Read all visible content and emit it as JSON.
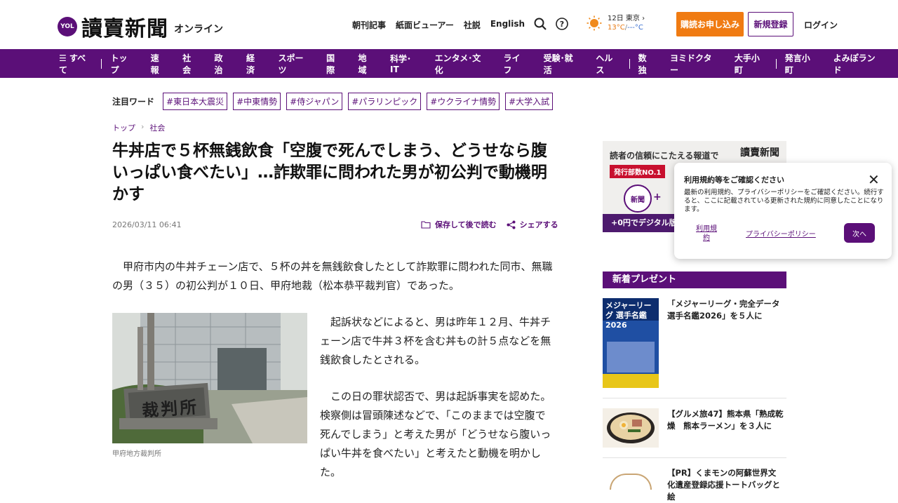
{
  "header": {
    "logo_badge": "YOL",
    "logo_main": "讀賣新聞",
    "logo_sub": "オンライン",
    "links": [
      "朝刊記事",
      "紙面ビューアー",
      "社説",
      "English"
    ],
    "weather": {
      "date_city": "12日 東京",
      "chevron": "›",
      "temp_max": "13°C",
      "temp_sep": "/",
      "temp_min": "---°C",
      "icon": "sun-icon"
    },
    "subscribe": "購読お申し込み",
    "register": "新規登録",
    "login": "ログイン"
  },
  "nav": {
    "all": "☰ すべて",
    "items": [
      "トップ",
      "速報",
      "社会",
      "政治",
      "経済",
      "スポーツ",
      "国際",
      "地域",
      "科学･IT",
      "エンタメ･文化",
      "ライフ",
      "受験･就活",
      "ヘルス"
    ],
    "items2": [
      "数独",
      "ヨミドクター",
      "大手小町"
    ],
    "items3": [
      "発言小町",
      "よみぽランド"
    ]
  },
  "keywords": {
    "label": "注目ワード",
    "tags": [
      "#東日本大震災",
      "#中東情勢",
      "#侍ジャパン",
      "#パラリンピック",
      "#ウクライナ情勢",
      "#大学入試"
    ]
  },
  "breadcrumb": {
    "home": "トップ",
    "sep": "›",
    "section": "社会"
  },
  "article": {
    "title": "牛丼店で５杯無銭飲食「空腹で死んでしまう、どうせなら腹いっぱい食べたい」…詐欺罪に問われた男が初公判で動機明かす",
    "date": "2026/03/11 06:41",
    "save": "保存して後で読む",
    "share": "シェアする",
    "lead": "　甲府市内の牛丼チェーン店で、５杯の丼を無銭飲食したとして詐欺罪に問われた同市、無職の男（３５）の初公判が１０日、甲府地裁（松本恭平裁判官）であった。",
    "para1": "　起訴状などによると、男は昨年１２月、牛丼チェーン店で牛丼３杯を含む丼もの計５点などを無銭飲食したとされる。",
    "para2": "　この日の罪状認否で、男は起訴事実を認めた。検察側は冒頭陳述などで、「このままでは空腹で死んでしまう」と考えた男が「どうせなら腹いっぱい牛丼を食べたい」と考えたと動機を明かした。",
    "photo_sign": "裁判所",
    "caption": "甲府地方裁判所"
  },
  "ad": {
    "headline": "読者の信頼にこたえる報道で",
    "logo": "讀賣新聞",
    "badge": "発行部数NO.1",
    "circle1": "新聞",
    "plus": "+",
    "bottom": "+0円でデジタル版が"
  },
  "modal": {
    "title": "利用規約等をご確認ください",
    "body": "最新の利用規約、プライバシーポリシーをご確認ください。続行すると、ここに記載されている更新された規約に同意したことになります。",
    "link_terms": "利用規約",
    "link_privacy": "プライバシーポリシー",
    "next": "次へ",
    "close": "✕"
  },
  "presents": {
    "heading": "新着プレゼント",
    "items": [
      {
        "text": "「メジャーリーグ・完全データ選手名鑑2026」を５人に",
        "thumb_title": "メジャーリーグ 選手名鑑 2026"
      },
      {
        "text": "【グルメ旅47】熊本県「熟成乾燥　熊本ラーメン」を３人に"
      },
      {
        "text": "【PR】くまモンの阿蘇世界文化遺産登録応援トートバッグと絵"
      }
    ]
  }
}
